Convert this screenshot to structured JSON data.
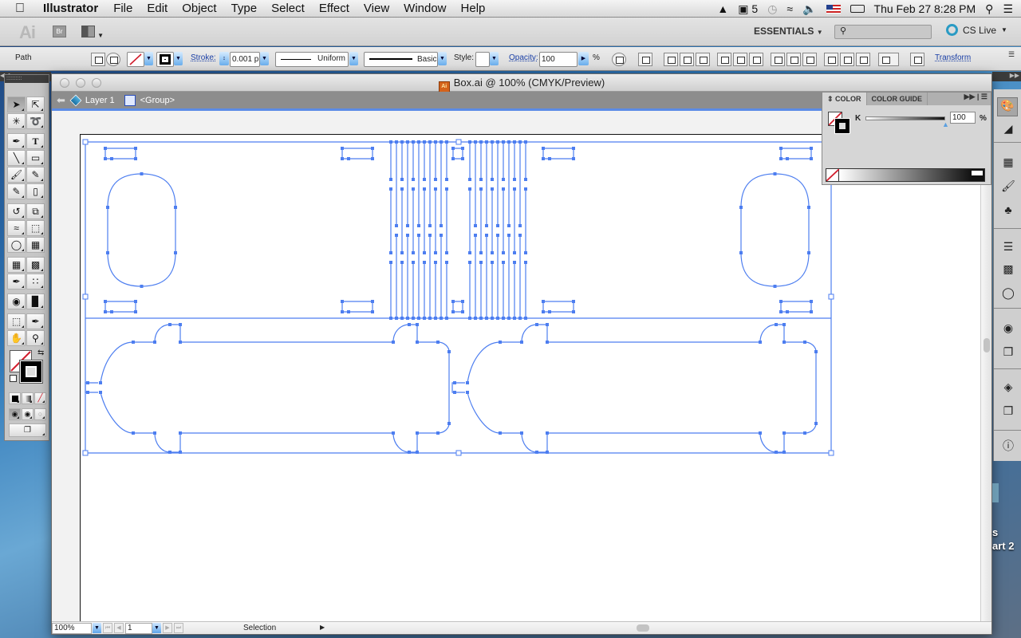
{
  "menubar": {
    "app_name": "Illustrator",
    "items": [
      "File",
      "Edit",
      "Object",
      "Type",
      "Select",
      "Effect",
      "View",
      "Window",
      "Help"
    ],
    "status": {
      "adobe_badge": "5",
      "datetime": "Thu Feb 27  8:28 PM"
    }
  },
  "appbar": {
    "logo": "Ai",
    "bridge_label": "Br",
    "workspace": "ESSENTIALS",
    "search_placeholder": "",
    "cs_live": "CS Live"
  },
  "controlbar": {
    "selection_type": "Path",
    "stroke_label": "Stroke:",
    "stroke_weight": "0.001 p",
    "profile": "Uniform",
    "brush": "Basic",
    "style_label": "Style:",
    "opacity_label": "Opacity:",
    "opacity_value": "100",
    "opacity_unit": "%",
    "transform_label": "Transform"
  },
  "document": {
    "title": "Box.ai @ 100% (CMYK/Preview)",
    "breadcrumb": {
      "layer": "Layer 1",
      "group": "<Group>"
    },
    "accent_color": "#4d7ef0"
  },
  "statusbar": {
    "zoom": "100%",
    "page": "1",
    "tool": "Selection"
  },
  "color_panel": {
    "tabs": [
      "COLOR",
      "COLOR GUIDE"
    ],
    "active_tab": "COLOR",
    "channel_label": "K",
    "channel_value": "100",
    "channel_unit": "%",
    "k_percent": 100
  },
  "tools": {
    "active": "Selection Tool"
  },
  "desktop": {
    "labels": [
      "s",
      "art 2"
    ]
  }
}
